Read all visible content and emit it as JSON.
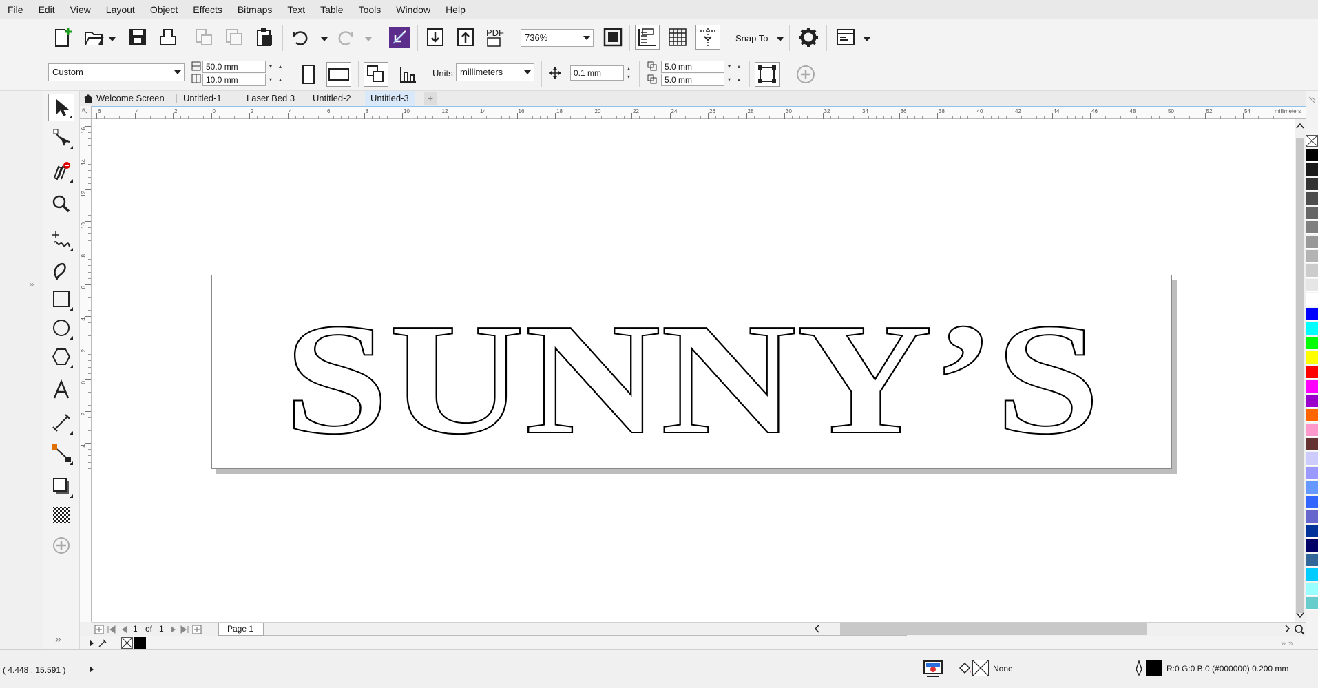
{
  "menu": [
    "File",
    "Edit",
    "View",
    "Layout",
    "Object",
    "Effects",
    "Bitmaps",
    "Text",
    "Table",
    "Tools",
    "Window",
    "Help"
  ],
  "std_toolbar": {
    "zoom_value": "736%",
    "pdf_label": "PDF",
    "snap_label": "Snap To"
  },
  "property_bar": {
    "page_preset": "Custom",
    "width_value": "50.0 mm",
    "height_value": "10.0 mm",
    "units_label": "Units:",
    "units_value": "millimeters",
    "nudge_value": "0.1 mm",
    "dup_x_value": "5.0 mm",
    "dup_y_value": "5.0 mm"
  },
  "tabs": [
    "Welcome Screen",
    "Untitled-1",
    "Laser Bed 3",
    "Untitled-2",
    "Untitled-3"
  ],
  "selected_tab": "Untitled-3",
  "ruler": {
    "h_labels": [
      "6",
      "4",
      "2",
      "0",
      "2",
      "4",
      "6",
      "8",
      "10",
      "12",
      "14",
      "16",
      "18",
      "20",
      "22",
      "24",
      "26",
      "28",
      "30",
      "32",
      "34",
      "36",
      "38",
      "40",
      "42",
      "44",
      "46",
      "48",
      "50",
      "52",
      "54"
    ],
    "unit": "millimeters",
    "v_labels": [
      "16",
      "14",
      "12",
      "10",
      "8",
      "6",
      "4",
      "2",
      "0",
      "2",
      "4"
    ]
  },
  "canvas": {
    "artwork_text": "SUNNY’S"
  },
  "page_nav": {
    "current": "1",
    "of_label": "of",
    "total": "1",
    "page_tab": "Page 1"
  },
  "status": {
    "coords": "( 4.448 , 15.591 )",
    "fill_label": "None",
    "outline_label": "R:0 G:0 B:0 (#000000)  0.200 mm"
  },
  "palette_colors": [
    "#000000",
    "#1a1a1a",
    "#333333",
    "#4d4d4d",
    "#666666",
    "#808080",
    "#999999",
    "#b3b3b3",
    "#cccccc",
    "#e6e6e6",
    "#ffffff",
    "#0000ff",
    "#00ffff",
    "#00ff00",
    "#ffff00",
    "#ff0000",
    "#ff00ff",
    "#9900cc",
    "#ff6600",
    "#ff99cc",
    "#663333",
    "#ccccff",
    "#9999ff",
    "#6699ff",
    "#3366ff",
    "#6666cc",
    "#003399",
    "#000066",
    "#336699",
    "#00ccff",
    "#99ffff",
    "#66cccc"
  ],
  "accent_colors": {
    "tab_selected": "#d9e9f9",
    "ruler_highlight": "#8fc3ee"
  }
}
